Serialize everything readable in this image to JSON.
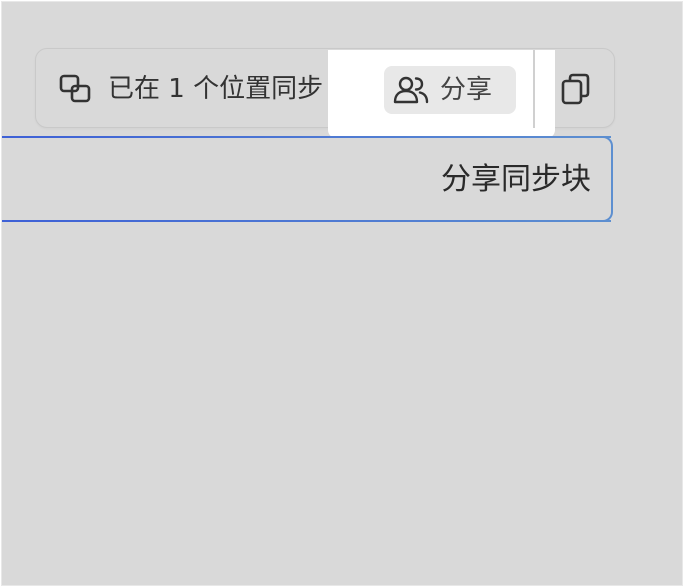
{
  "toolbar": {
    "sync_status": "已在 1 个位置同步",
    "share_label": "分享",
    "icons": {
      "sync": "sync-blocks-icon",
      "share": "people-icon",
      "copy": "copy-icon"
    }
  },
  "sync_block": {
    "text": "分享同步块"
  },
  "colors": {
    "background": "#d9d9d9",
    "highlight": "#ffffff",
    "share_button_bg": "#e8e8e8",
    "block_border_start": "#3d5fd6",
    "block_border_end": "#5d8fd0",
    "text": "#333333"
  }
}
